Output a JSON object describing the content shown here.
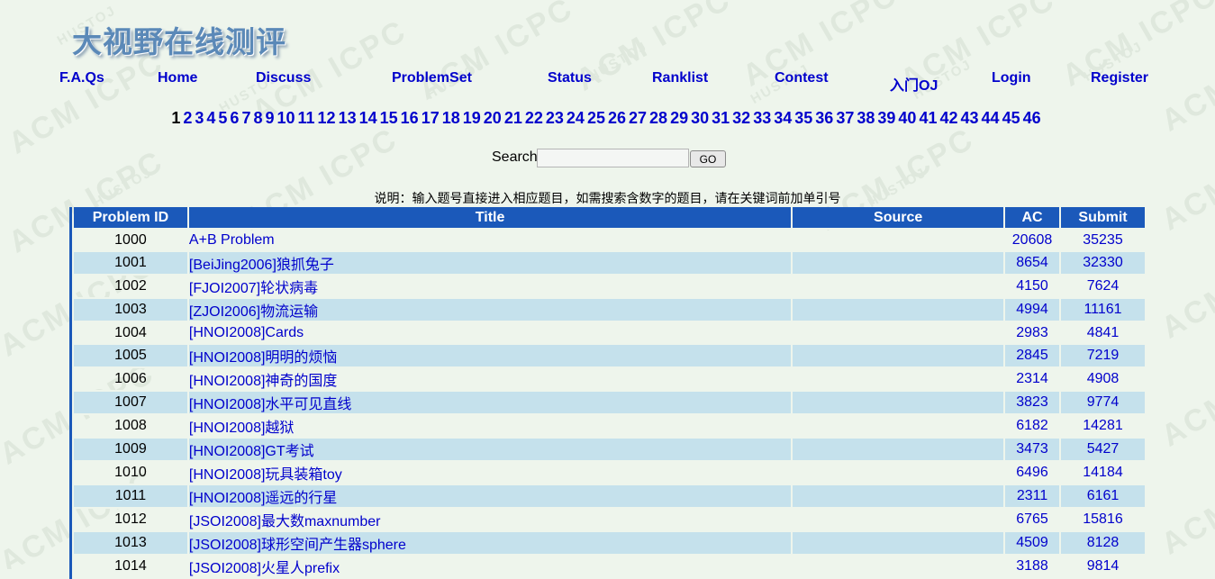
{
  "header": {
    "logo_text": "大视野在线测评"
  },
  "nav": {
    "items": [
      {
        "label": "F.A.Qs"
      },
      {
        "label": "Home"
      },
      {
        "label": "Discuss"
      },
      {
        "label": "ProblemSet"
      },
      {
        "label": "Status"
      },
      {
        "label": "Ranklist"
      },
      {
        "label": "Contest"
      },
      {
        "label": "入门OJ"
      },
      {
        "label": "Login"
      },
      {
        "label": "Register"
      }
    ]
  },
  "pagination": {
    "current": "1",
    "pages": [
      "1",
      "2",
      "3",
      "4",
      "5",
      "6",
      "7",
      "8",
      "9",
      "10",
      "11",
      "12",
      "13",
      "14",
      "15",
      "16",
      "17",
      "18",
      "19",
      "20",
      "21",
      "22",
      "23",
      "24",
      "25",
      "26",
      "27",
      "28",
      "29",
      "30",
      "31",
      "32",
      "33",
      "34",
      "35",
      "36",
      "37",
      "38",
      "39",
      "40",
      "41",
      "42",
      "43",
      "44",
      "45",
      "46"
    ]
  },
  "search": {
    "label": "Search",
    "value": "",
    "button": "GO"
  },
  "note": "说明：输入题号直接进入相应题目，如需搜索含数字的题目，请在关键词前加单引号",
  "table": {
    "headers": {
      "id": "Problem ID",
      "title": "Title",
      "source": "Source",
      "ac": "AC",
      "submit": "Submit"
    },
    "rows": [
      {
        "id": "1000",
        "title": "A+B Problem",
        "source": "",
        "ac": "20608",
        "submit": "35235"
      },
      {
        "id": "1001",
        "title": "[BeiJing2006]狼抓兔子",
        "source": "",
        "ac": "8654",
        "submit": "32330"
      },
      {
        "id": "1002",
        "title": "[FJOI2007]轮状病毒",
        "source": "",
        "ac": "4150",
        "submit": "7624"
      },
      {
        "id": "1003",
        "title": "[ZJOI2006]物流运输",
        "source": "",
        "ac": "4994",
        "submit": "11161"
      },
      {
        "id": "1004",
        "title": "[HNOI2008]Cards",
        "source": "",
        "ac": "2983",
        "submit": "4841"
      },
      {
        "id": "1005",
        "title": "[HNOI2008]明明的烦恼",
        "source": "",
        "ac": "2845",
        "submit": "7219"
      },
      {
        "id": "1006",
        "title": "[HNOI2008]神奇的国度",
        "source": "",
        "ac": "2314",
        "submit": "4908"
      },
      {
        "id": "1007",
        "title": "[HNOI2008]水平可见直线",
        "source": "",
        "ac": "3823",
        "submit": "9774"
      },
      {
        "id": "1008",
        "title": "[HNOI2008]越狱",
        "source": "",
        "ac": "6182",
        "submit": "14281"
      },
      {
        "id": "1009",
        "title": "[HNOI2008]GT考试",
        "source": "",
        "ac": "3473",
        "submit": "5427"
      },
      {
        "id": "1010",
        "title": "[HNOI2008]玩具装箱toy",
        "source": "",
        "ac": "6496",
        "submit": "14184"
      },
      {
        "id": "1011",
        "title": "[HNOI2008]遥远的行星",
        "source": "",
        "ac": "2311",
        "submit": "6161"
      },
      {
        "id": "1012",
        "title": "[JSOI2008]最大数maxnumber",
        "source": "",
        "ac": "6765",
        "submit": "15816"
      },
      {
        "id": "1013",
        "title": "[JSOI2008]球形空间产生器sphere",
        "source": "",
        "ac": "4509",
        "submit": "8128"
      },
      {
        "id": "1014",
        "title": "[JSOI2008]火星人prefix",
        "source": "",
        "ac": "3188",
        "submit": "9814"
      }
    ]
  },
  "watermark": {
    "big": "ACM ICPC",
    "small": "HUSTOJ"
  },
  "colors": {
    "background": "#eef5ec",
    "header_blue": "#1b59ba",
    "row_alt": "#c5e1ec",
    "link": "#0000cc"
  }
}
